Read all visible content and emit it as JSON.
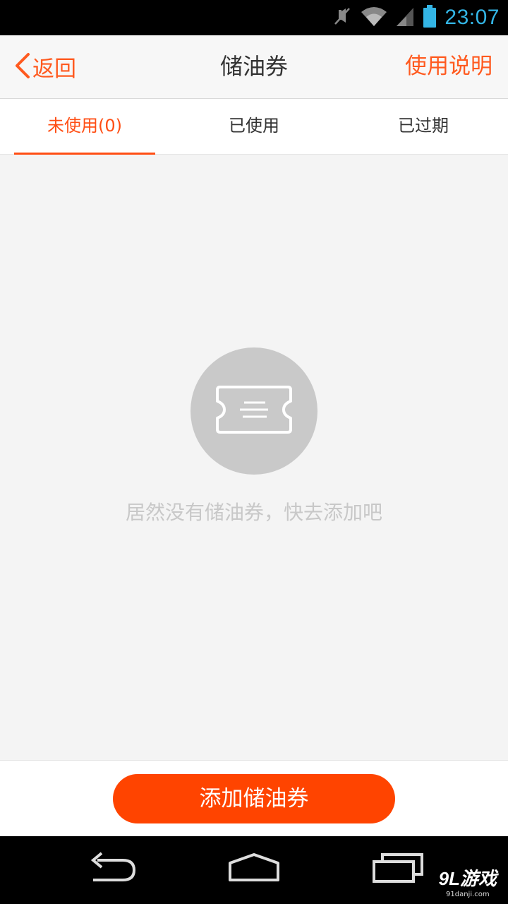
{
  "status_bar": {
    "time": "23:07",
    "icons": [
      "mute-icon",
      "wifi-icon",
      "signal-icon",
      "battery-icon"
    ]
  },
  "header": {
    "back_label": "返回",
    "title": "储油券",
    "help_label": "使用说明"
  },
  "tabs": [
    {
      "label": "未使用(0)",
      "active": true
    },
    {
      "label": "已使用",
      "active": false
    },
    {
      "label": "已过期",
      "active": false
    }
  ],
  "empty_state": {
    "icon": "ticket-icon",
    "message": "居然没有储油券，快去添加吧"
  },
  "actions": {
    "add_label": "添加储油券"
  },
  "nav_bar": {
    "icons": [
      "back-nav-icon",
      "home-nav-icon",
      "recents-nav-icon"
    ]
  },
  "watermark": {
    "logo": "9L游戏",
    "url": "91danji.com"
  },
  "colors": {
    "accent": "#ff5a1f",
    "button": "#ff4400",
    "time": "#33b5e5",
    "empty_circle": "#c9c9c9"
  }
}
